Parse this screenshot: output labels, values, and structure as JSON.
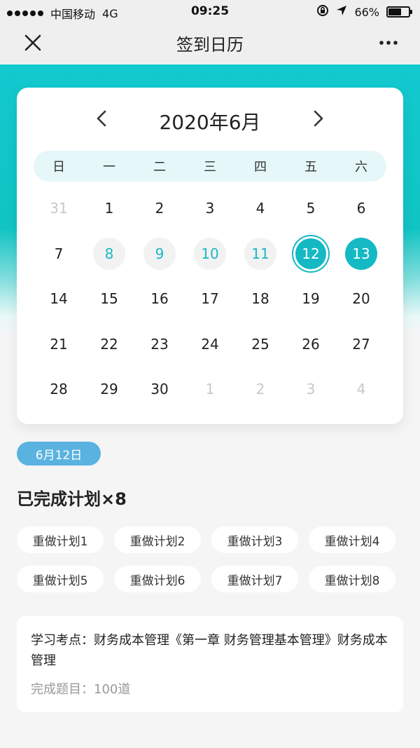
{
  "status": {
    "carrier": "中国移动",
    "network": "4G",
    "time": "09:25",
    "battery_percent": "66%",
    "battery_level": 0.66
  },
  "nav": {
    "title": "签到日历",
    "close_icon": "close-icon",
    "more_icon": "more-icon"
  },
  "calendar": {
    "month_title": "2020年6月",
    "weekdays": [
      "日",
      "一",
      "二",
      "三",
      "四",
      "五",
      "六"
    ],
    "days": [
      {
        "label": "31",
        "state": "other"
      },
      {
        "label": "1",
        "state": "normal"
      },
      {
        "label": "2",
        "state": "normal"
      },
      {
        "label": "3",
        "state": "normal"
      },
      {
        "label": "4",
        "state": "normal"
      },
      {
        "label": "5",
        "state": "normal"
      },
      {
        "label": "6",
        "state": "normal"
      },
      {
        "label": "7",
        "state": "normal"
      },
      {
        "label": "8",
        "state": "done"
      },
      {
        "label": "9",
        "state": "done"
      },
      {
        "label": "10",
        "state": "done"
      },
      {
        "label": "11",
        "state": "done"
      },
      {
        "label": "12",
        "state": "selected"
      },
      {
        "label": "13",
        "state": "today"
      },
      {
        "label": "14",
        "state": "normal"
      },
      {
        "label": "15",
        "state": "normal"
      },
      {
        "label": "16",
        "state": "normal"
      },
      {
        "label": "17",
        "state": "normal"
      },
      {
        "label": "18",
        "state": "normal"
      },
      {
        "label": "19",
        "state": "normal"
      },
      {
        "label": "20",
        "state": "normal"
      },
      {
        "label": "21",
        "state": "normal"
      },
      {
        "label": "22",
        "state": "normal"
      },
      {
        "label": "23",
        "state": "normal"
      },
      {
        "label": "24",
        "state": "normal"
      },
      {
        "label": "25",
        "state": "normal"
      },
      {
        "label": "26",
        "state": "normal"
      },
      {
        "label": "27",
        "state": "normal"
      },
      {
        "label": "28",
        "state": "normal"
      },
      {
        "label": "29",
        "state": "normal"
      },
      {
        "label": "30",
        "state": "normal"
      },
      {
        "label": "1",
        "state": "other"
      },
      {
        "label": "2",
        "state": "other"
      },
      {
        "label": "3",
        "state": "other"
      },
      {
        "label": "4",
        "state": "other"
      }
    ]
  },
  "detail": {
    "date_badge": "6月12日",
    "completed_title": "已完成计划×8",
    "plans": [
      "重做计划1",
      "重做计划2",
      "重做计划3",
      "重做计划4",
      "重做计划5",
      "重做计划6",
      "重做计划7",
      "重做计划8"
    ],
    "study_point": "学习考点：财务成本管理《第一章 财务管理基本管理》财务成本管理",
    "finished_questions": "完成题目：100道"
  },
  "colors": {
    "accent": "#14b9c4",
    "badge": "#5ab2e0",
    "teal_band": "#12c9cf"
  }
}
